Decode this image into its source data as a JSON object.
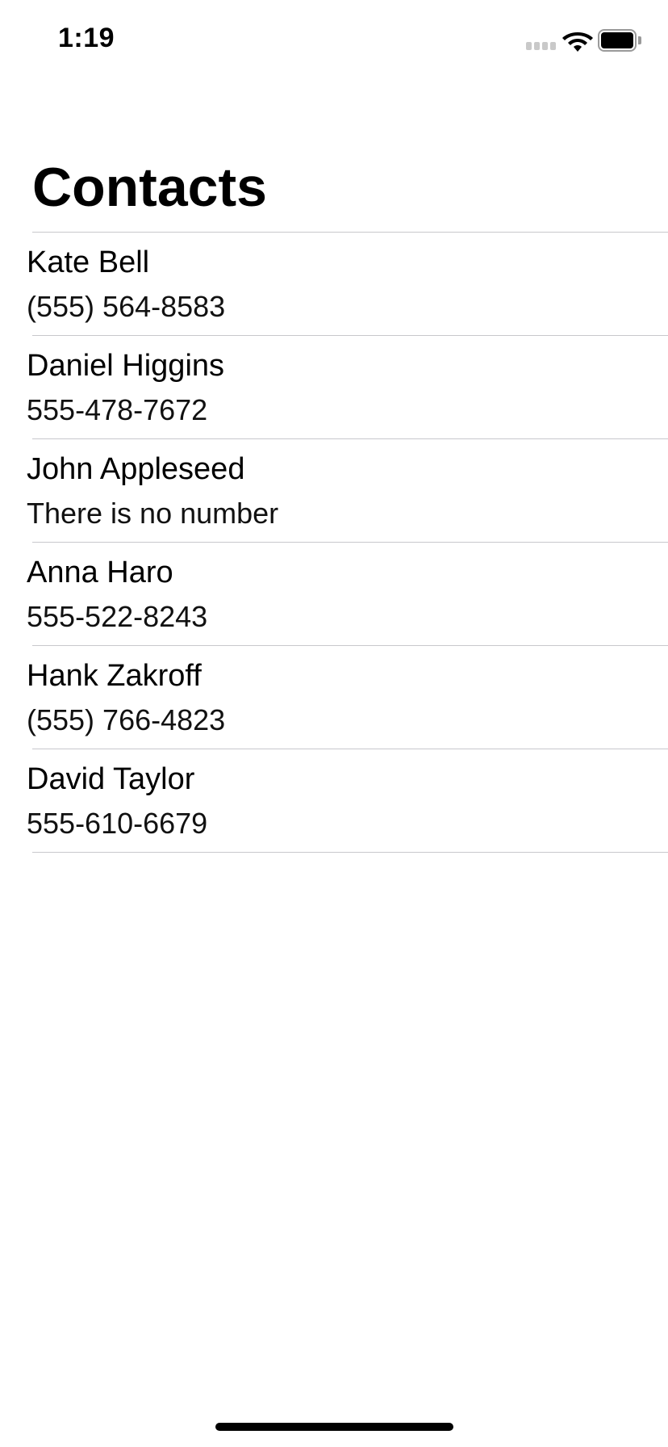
{
  "status_bar": {
    "time": "1:19",
    "icons": [
      "signal-icon",
      "wifi-icon",
      "battery-icon"
    ]
  },
  "header": {
    "title": "Contacts"
  },
  "contacts": [
    {
      "name": "Kate Bell",
      "phone": "(555) 564-8583"
    },
    {
      "name": "Daniel Higgins",
      "phone": "555-478-7672"
    },
    {
      "name": "John Appleseed",
      "phone": "There is no number"
    },
    {
      "name": "Anna Haro",
      "phone": "555-522-8243"
    },
    {
      "name": "Hank Zakroff",
      "phone": "(555) 766-4823"
    },
    {
      "name": "David Taylor",
      "phone": "555-610-6679"
    }
  ],
  "colors": {
    "background": "#ffffff",
    "text": "#000000",
    "separator": "#c8c8cc"
  }
}
